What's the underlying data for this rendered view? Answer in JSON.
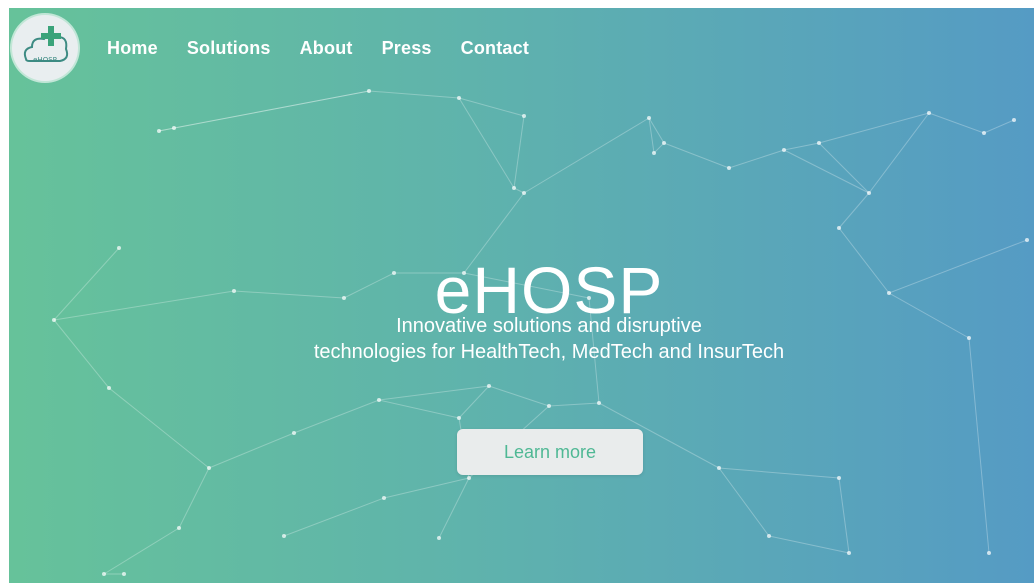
{
  "brand": {
    "logo_text": "eHOSP"
  },
  "nav": {
    "items": [
      {
        "label": "Home"
      },
      {
        "label": "Solutions"
      },
      {
        "label": "About"
      },
      {
        "label": "Press"
      },
      {
        "label": "Contact"
      }
    ]
  },
  "hero": {
    "title": "eHOSP",
    "subtitle_line1": "Innovative solutions and disruptive",
    "subtitle_line2": "technologies for HealthTech, MedTech and InsurTech",
    "cta_label": "Learn more"
  },
  "colors": {
    "gradient_start": "#66c29a",
    "gradient_end": "#559bc4",
    "cta_text": "#4fb894",
    "cta_background": "#e9ecec"
  },
  "icons": {
    "logo": "cloud-medical-cross-icon"
  }
}
